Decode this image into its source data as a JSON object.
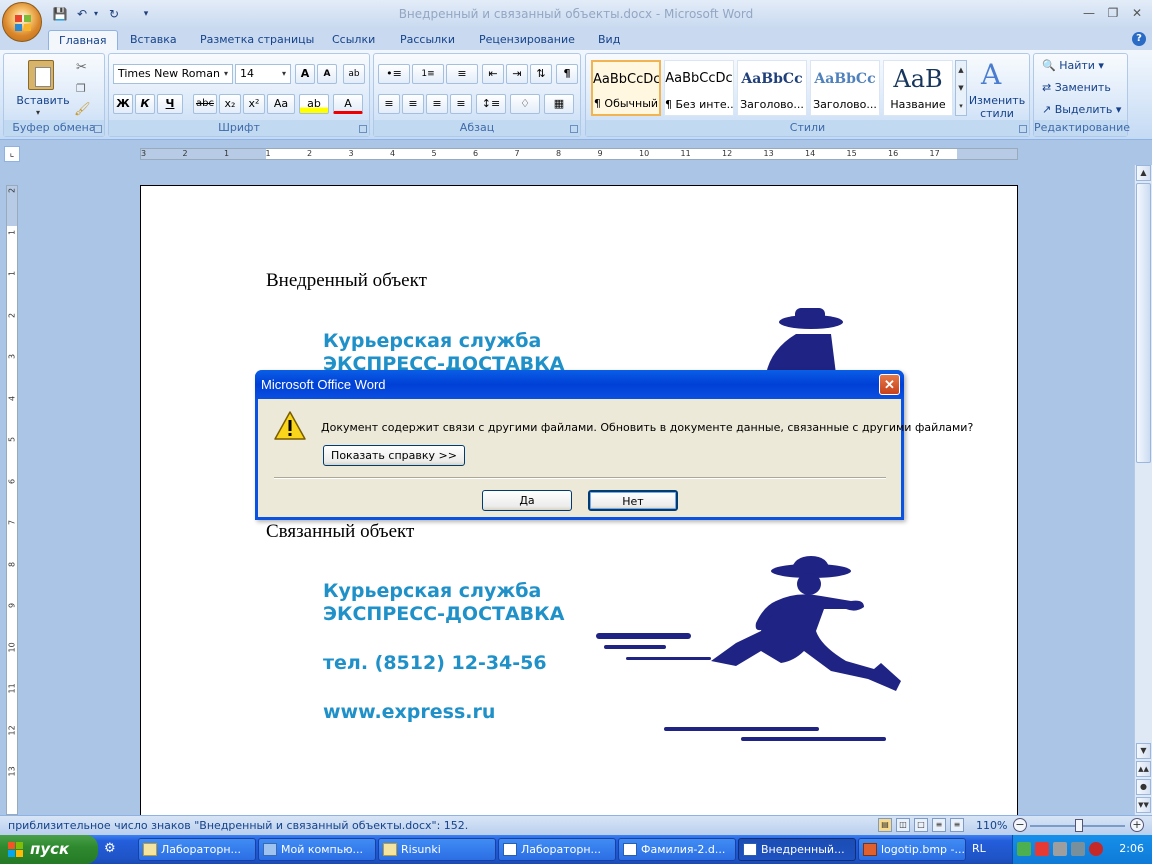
{
  "window": {
    "title": "Внедренный и связанный объекты.docx - Microsoft Word"
  },
  "tabs": [
    "Главная",
    "Вставка",
    "Разметка страницы",
    "Ссылки",
    "Рассылки",
    "Рецензирование",
    "Вид"
  ],
  "ribbon": {
    "clipboard": {
      "label": "Буфер обмена",
      "paste": "Вставить"
    },
    "font": {
      "label": "Шрифт",
      "name": "Times New Roman",
      "size": "14",
      "bold": "Ж",
      "italic": "К",
      "underline": "Ч",
      "strike": "abc",
      "sub": "x₂",
      "sup": "x²",
      "case": "Aa",
      "grow": "A",
      "shrink": "A"
    },
    "paragraph": {
      "label": "Абзац",
      "pilcrow": "¶"
    },
    "styles": {
      "label": "Стили",
      "items": [
        {
          "sample": "AaBbCcDc",
          "name": "¶ Обычный"
        },
        {
          "sample": "AaBbCcDc",
          "name": "¶ Без инте..."
        },
        {
          "sample": "AaBbCc",
          "name": "Заголово..."
        },
        {
          "sample": "AaBbCc",
          "name": "Заголово..."
        },
        {
          "sample": "AaB",
          "name": "Название"
        }
      ],
      "change": "Изменить стили"
    },
    "editing": {
      "label": "Редактирование",
      "find": "Найти",
      "replace": "Заменить",
      "select": "Выделить"
    }
  },
  "ruler": {
    "ticks": [
      "3",
      "2",
      "1",
      "1",
      "2",
      "3",
      "4",
      "5",
      "6",
      "7",
      "8",
      "9",
      "10",
      "11",
      "12",
      "13",
      "14",
      "15",
      "16",
      "17"
    ],
    "vticks": [
      "2",
      "1",
      "1",
      "2",
      "3",
      "4",
      "5",
      "6",
      "7",
      "8",
      "9",
      "10",
      "11",
      "12",
      "13"
    ]
  },
  "document": {
    "embedded_heading": "Внедренный объект",
    "linked_heading": "Связанный объект",
    "logo": {
      "line1": "Курьерская служба",
      "line2": "ЭКСПРЕСС-ДОСТАВКА",
      "phone": "тел. (8512) 12-34-56",
      "site": "www.express.ru"
    }
  },
  "dialog": {
    "title": "Microsoft Office Word",
    "message": "Документ содержит связи с другими файлами. Обновить в документе данные, связанные с другими файлами?",
    "help_button": "Показать справку >>",
    "yes": "Да",
    "no": "Нет"
  },
  "status": {
    "text": "приблизительное число знаков \"Внедренный и связанный объекты.docx\": 152.",
    "zoom": "110%"
  },
  "taskbar": {
    "start": "пуск",
    "tasks": [
      "Лабораторн...",
      "Мой компью...",
      "Risunki",
      "Лабораторн...",
      "Фамилия-2.d...",
      "Внедренный...",
      "logotip.bmp -..."
    ],
    "lang": "RL",
    "clock": "2:06"
  },
  "colors": {
    "logo_blue": "#1f91c8",
    "runner_navy": "#1f2383",
    "dialog_title": "#0a53e2"
  }
}
